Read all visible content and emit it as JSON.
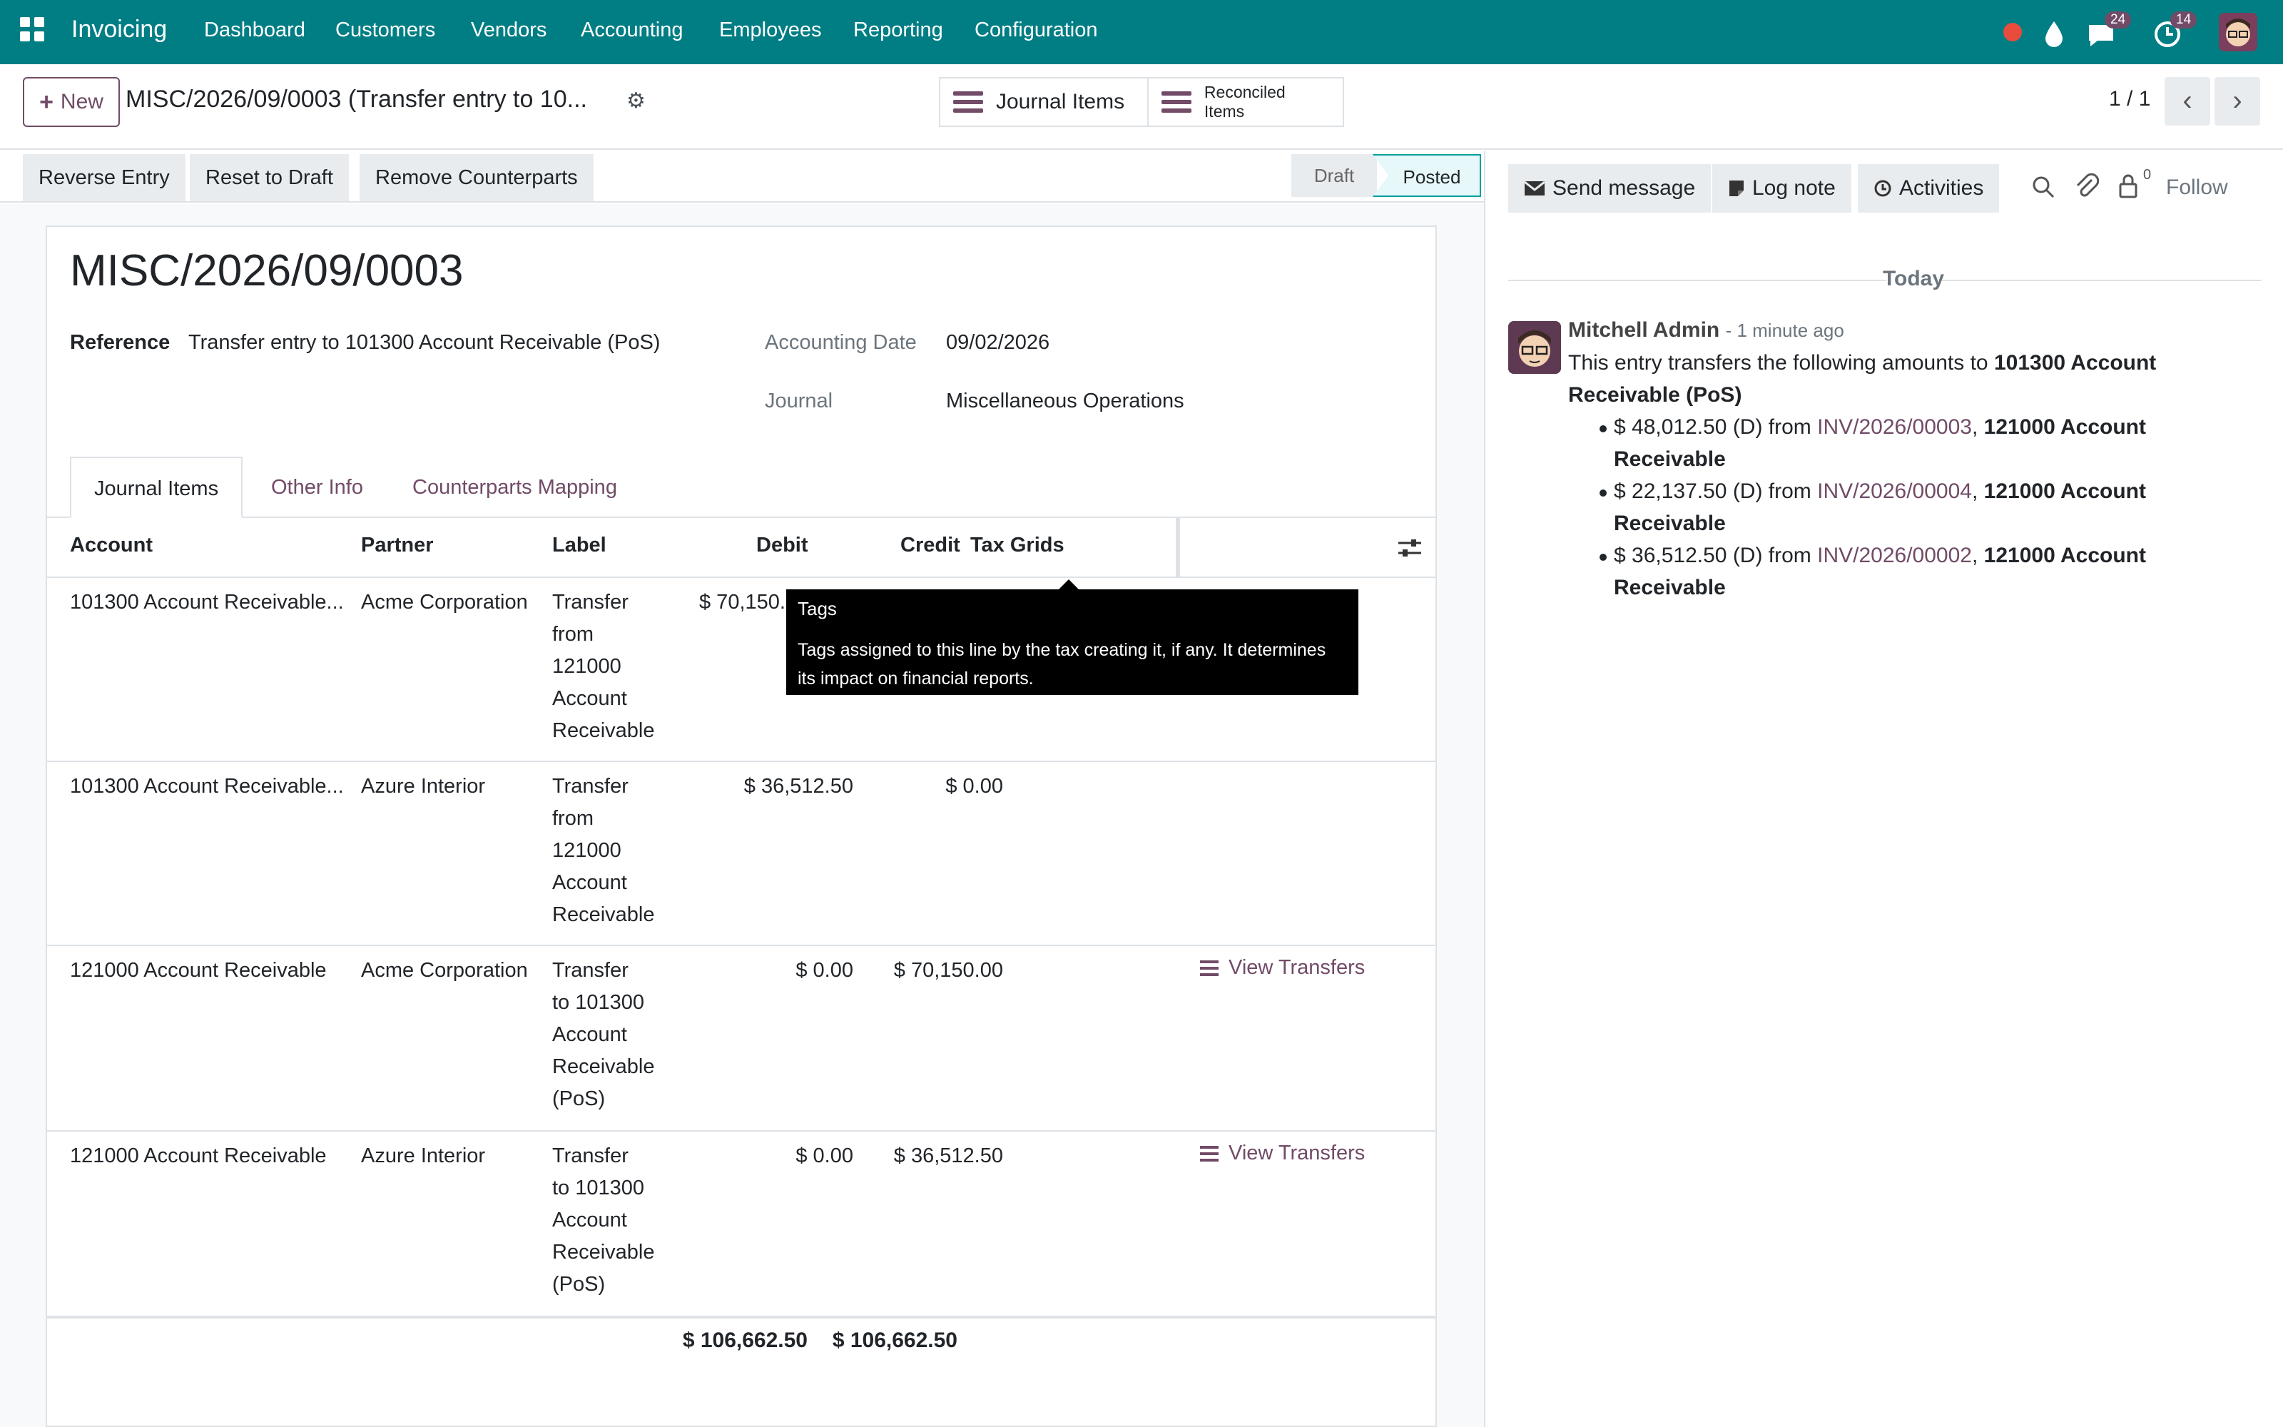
{
  "topnav": {
    "app_name": "Invoicing",
    "menus": [
      "Dashboard",
      "Customers",
      "Vendors",
      "Accounting",
      "Employees",
      "Reporting",
      "Configuration"
    ],
    "chat_badge": "24",
    "activity_badge": "14",
    "color": "#017e84"
  },
  "control": {
    "new_label": "New",
    "breadcrumb": "MISC/2026/09/0003 (Transfer entry to 10...",
    "smart_journal_items": "Journal Items",
    "smart_reconciled_items": "Reconciled Items",
    "pager": "1 / 1"
  },
  "statusbar": {
    "reverse_entry": "Reverse Entry",
    "reset_to_draft": "Reset to Draft",
    "remove_counterparts": "Remove Counterparts",
    "stage_draft": "Draft",
    "stage_posted": "Posted"
  },
  "form": {
    "title": "MISC/2026/09/0003",
    "reference_label": "Reference",
    "reference_value": "Transfer entry to 101300 Account Receivable (PoS)",
    "accounting_date_label": "Accounting Date",
    "accounting_date_value": "09/02/2026",
    "journal_label": "Journal",
    "journal_value": "Miscellaneous Operations",
    "tabs": [
      "Journal Items",
      "Other Info",
      "Counterparts Mapping"
    ],
    "columns": [
      "Account",
      "Partner",
      "Label",
      "Debit",
      "Credit",
      "Tax Grids"
    ],
    "rows": [
      {
        "account": "101300 Account Receivable...",
        "partner": "Acme Corporation",
        "label": [
          "Transfer",
          "from",
          "121000",
          "Account",
          "Receivable"
        ],
        "debit": "$ 70,150.00",
        "credit": "",
        "action": ""
      },
      {
        "account": "101300 Account Receivable...",
        "partner": "Azure Interior",
        "label": [
          "Transfer",
          "from",
          "121000",
          "Account",
          "Receivable"
        ],
        "debit": "$ 36,512.50",
        "credit": "$ 0.00",
        "action": ""
      },
      {
        "account": "121000 Account Receivable",
        "partner": "Acme Corporation",
        "label": [
          "Transfer",
          "to 101300",
          "Account",
          "Receivable",
          "(PoS)"
        ],
        "debit": "$ 0.00",
        "credit": "$ 70,150.00",
        "action": "View Transfers"
      },
      {
        "account": "121000 Account Receivable",
        "partner": "Azure Interior",
        "label": [
          "Transfer",
          "to 101300",
          "Account",
          "Receivable",
          "(PoS)"
        ],
        "debit": "$ 0.00",
        "credit": "$ 36,512.50",
        "action": "View Transfers"
      }
    ],
    "total_debit": "$ 106,662.50",
    "total_credit": "$ 106,662.50"
  },
  "tooltip": {
    "title": "Tags",
    "body": "Tags assigned to this line by the tax creating it, if any. It determines its impact on financial reports."
  },
  "chatter": {
    "send_message": "Send message",
    "log_note": "Log note",
    "activities": "Activities",
    "followers_count": "0",
    "follow": "Follow",
    "date_separator": "Today",
    "author": "Mitchell Admin",
    "time": "- 1 minute ago",
    "intro_plain": "This entry transfers the following amounts to ",
    "intro_bold_1": "101300 Account",
    "intro_bold_2": "Receivable (PoS)",
    "items": [
      {
        "amount": "$ 48,012.50 (D) from ",
        "invoice": "INV/2026/00003",
        "account_1": "121000 Account",
        "account_2": "Receivable"
      },
      {
        "amount": "$ 22,137.50 (D) from ",
        "invoice": "INV/2026/00004",
        "account_1": "121000 Account",
        "account_2": "Receivable"
      },
      {
        "amount": "$ 36,512.50 (D) from ",
        "invoice": "INV/2026/00002",
        "account_1": "121000 Account",
        "account_2": "Receivable"
      }
    ]
  }
}
